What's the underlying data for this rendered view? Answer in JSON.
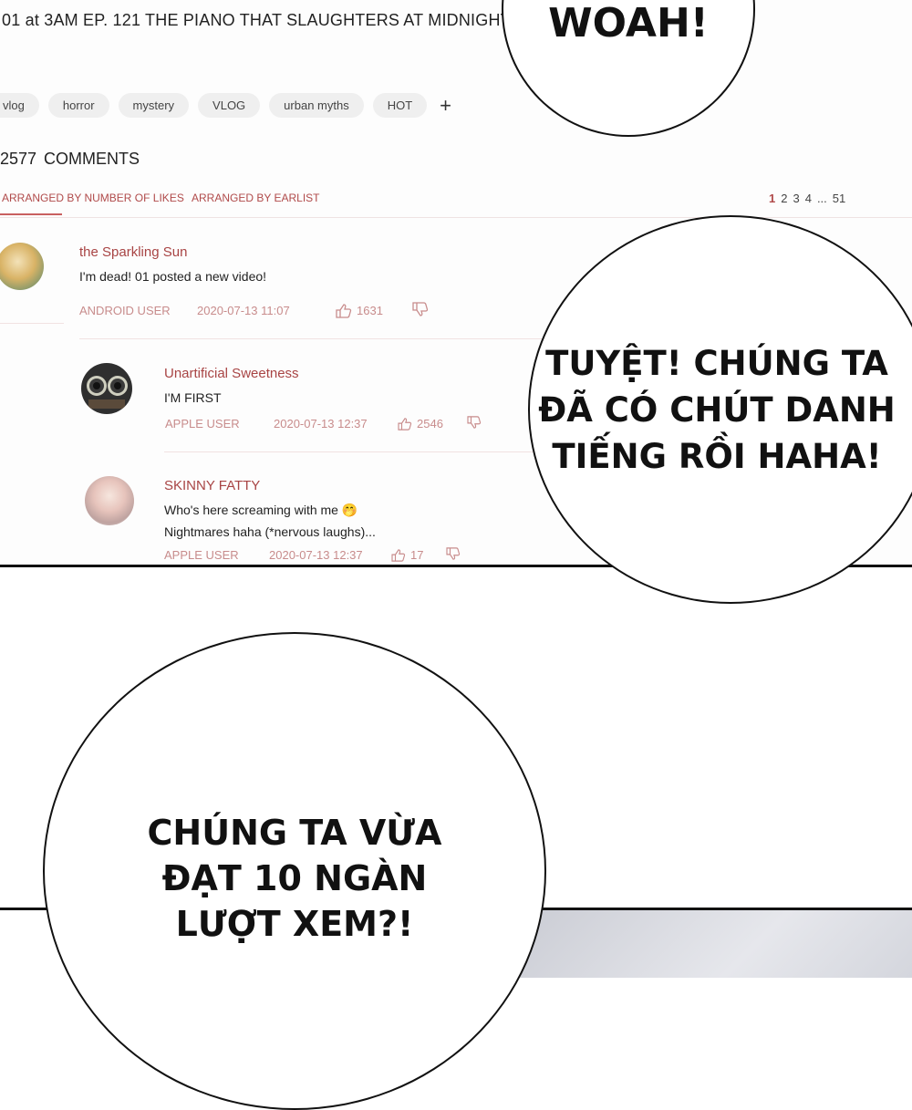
{
  "header": {
    "title": "01 at 3AM EP. 121 THE PIANO THAT SLAUGHTERS AT MIDNIGHT"
  },
  "tags": [
    "vlog",
    "horror",
    "mystery",
    "VLOG",
    "urban myths",
    "HOT"
  ],
  "tag_add_label": "+",
  "comments_header": {
    "count": "2577",
    "label": "COMMENTS"
  },
  "sort": {
    "by_likes": "ARRANGED BY NUMBER OF LIKES",
    "by_earliest": "ARRANGED BY EARLIST"
  },
  "pagination": {
    "current": "1",
    "pages": [
      "2",
      "3",
      "4",
      "...",
      "51"
    ]
  },
  "comments": [
    {
      "name": "the Sparkling Sun",
      "text": "I'm dead! 01 posted a new video!",
      "platform": "ANDROID USER",
      "date": "2020-07-13 11:07",
      "likes": "1631"
    },
    {
      "name": "Unartificial Sweetness",
      "text": "I'M FIRST",
      "platform": "APPLE USER",
      "date": "2020-07-13 12:37",
      "likes": "2546"
    },
    {
      "name": "SKINNY FATTY",
      "text": "Who's here screaming with me 🤭",
      "text2": "Nightmares haha (*nervous laughs)...",
      "platform": "APPLE USER",
      "date": "2020-07-13 12:37",
      "likes": "17"
    }
  ],
  "bubbles": {
    "woah": "WOAH!",
    "famous": [
      "TUYỆT! CHÚNG TA",
      "ĐÃ CÓ CHÚT DANH",
      "TIẾNG RỒI HAHA!"
    ],
    "views": [
      "CHÚNG TA VỪA",
      "ĐẠT 10 NGÀN",
      "LƯỢT XEM?!"
    ]
  },
  "colors": {
    "accent": "#a84444",
    "meta": "#c88c8c",
    "tag_bg": "#efefef",
    "ink": "#111111"
  },
  "icons": [
    "thumbs-up-icon",
    "thumbs-down-icon",
    "plus-icon"
  ]
}
